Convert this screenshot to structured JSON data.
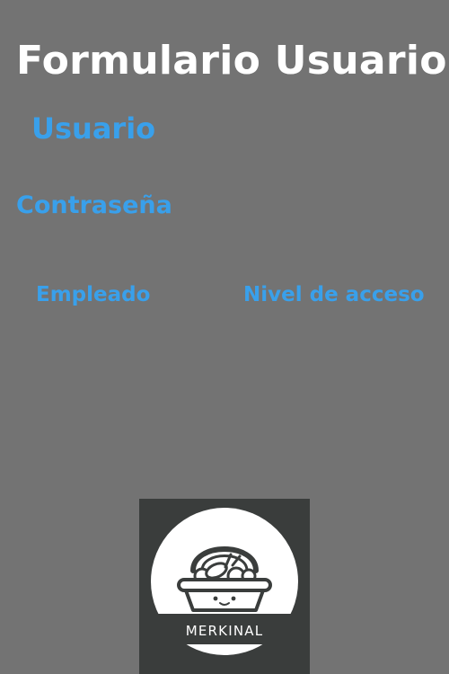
{
  "form": {
    "title": "Formulario Usuario",
    "user_label": "Usuario",
    "password_label": "Contraseña",
    "employee_label": "Empleado",
    "access_level_label": "Nivel de acceso"
  },
  "logo": {
    "text": "MERKINAL",
    "icon": "basket-icon"
  },
  "colors": {
    "background": "#737373",
    "title": "#ffffff",
    "label": "#39a0eb",
    "logo_bg": "#3a3d3c"
  }
}
